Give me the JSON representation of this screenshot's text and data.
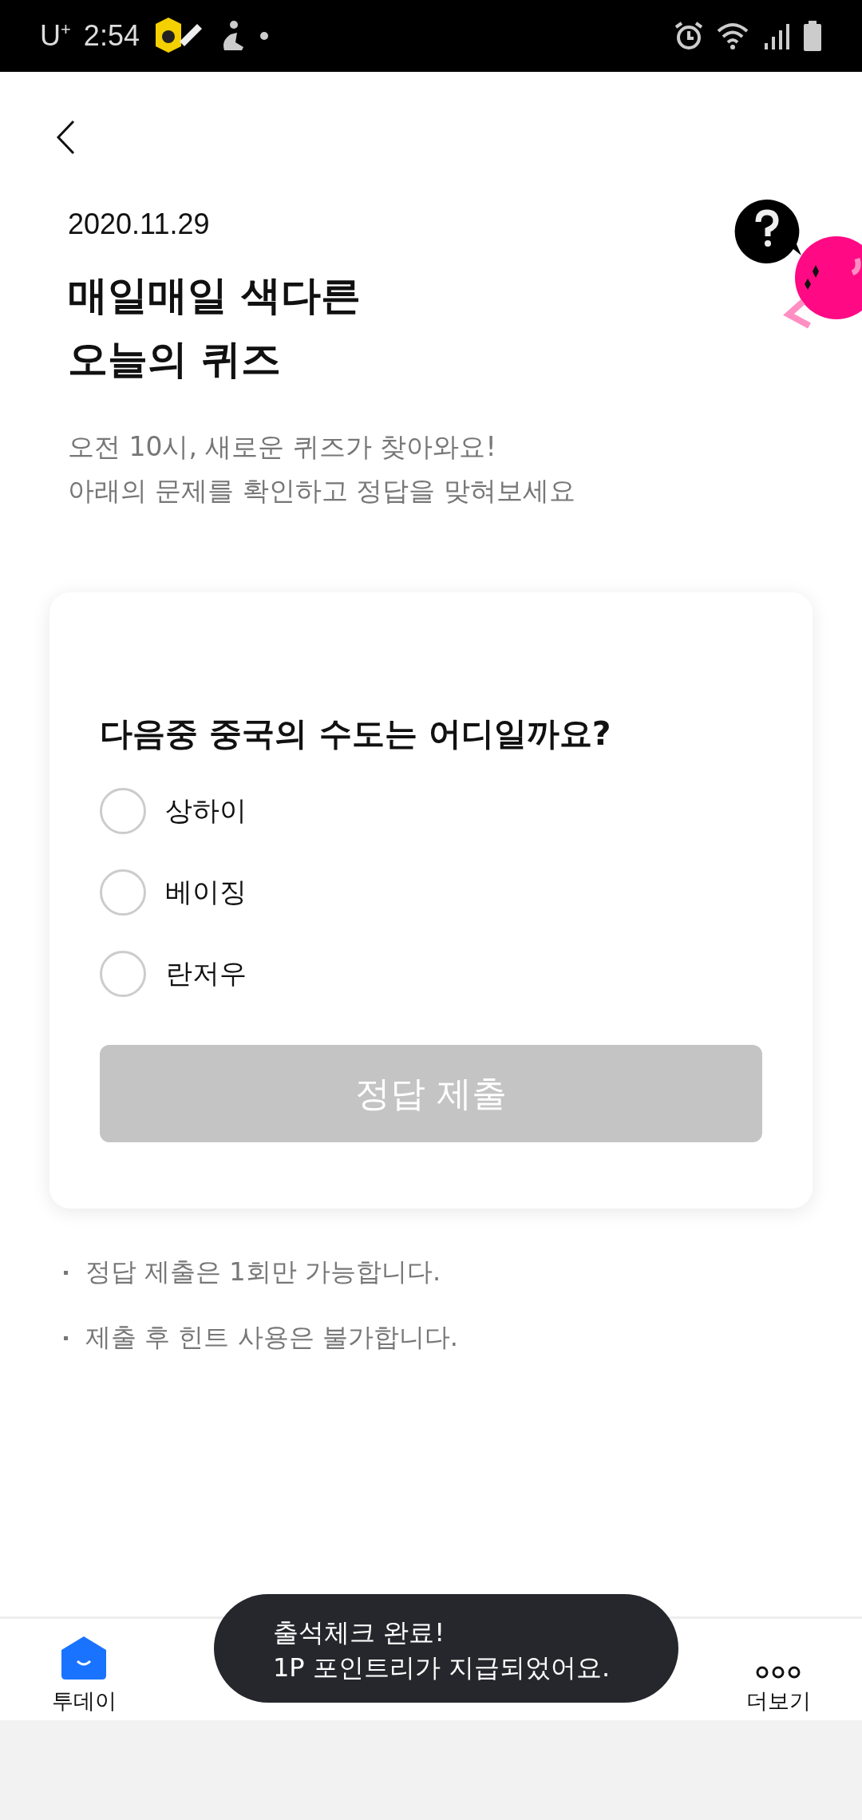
{
  "status_bar": {
    "carrier": "U$^{+}$",
    "time": "2:54"
  },
  "header": {
    "date": "2020.11.29",
    "title_lines": [
      "매일매일 색다른",
      "오늘의 퀴즈"
    ],
    "subtitle_lines": [
      "오전 10시, 새로운 퀴즈가 찾아와요!",
      "아래의 문제를 확인하고 정답을 맞혀보세요"
    ]
  },
  "quiz": {
    "question": "다음중 중국의 수도는 어디일까요?",
    "options": [
      {
        "label": "상하이",
        "selected": false
      },
      {
        "label": "베이징",
        "selected": false
      },
      {
        "label": "란저우",
        "selected": false
      }
    ],
    "submit": {
      "label": "정답 제출",
      "disabled": true
    }
  },
  "notes": [
    "정답 제출은 1회만 가능합니다.",
    "제출 후 힌트 사용은 불가합니다."
  ],
  "bottom_nav": [
    {
      "label": "투데이",
      "kind": "home",
      "selected": true
    },
    {
      "label": "더보기",
      "kind": "more",
      "selected": false
    }
  ],
  "toast": {
    "lines": [
      "출석체크 완료!",
      "1P 포인트리가 지급되었어요."
    ]
  }
}
